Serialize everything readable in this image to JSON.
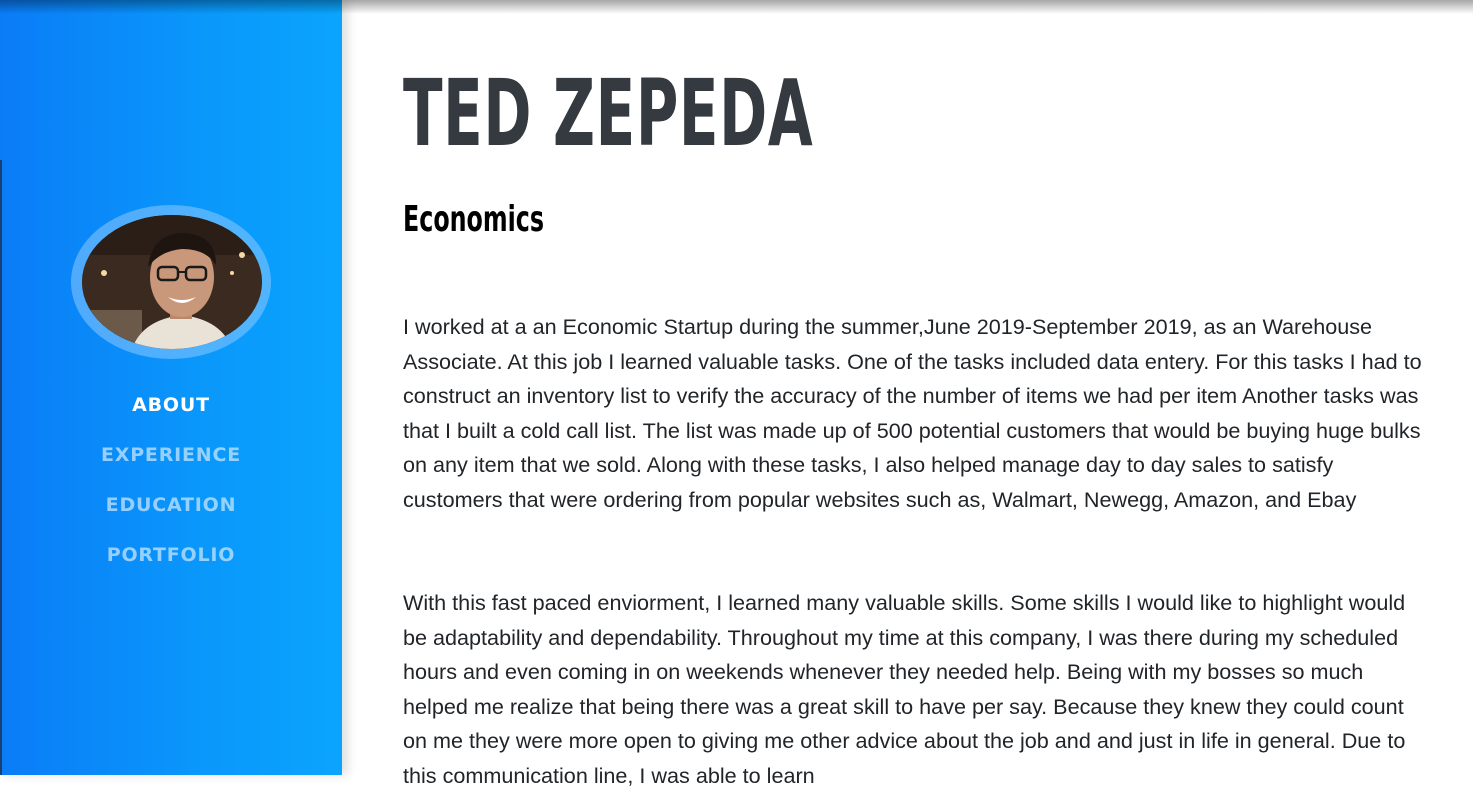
{
  "profile": {
    "name": "TED ZEPEDA",
    "subtitle": "Economics",
    "avatar_alt": "profile photo"
  },
  "nav": {
    "items": [
      {
        "label": "ABOUT",
        "active": true
      },
      {
        "label": "EXPERIENCE",
        "active": false
      },
      {
        "label": "EDUCATION",
        "active": false
      },
      {
        "label": "PORTFOLIO",
        "active": false
      }
    ]
  },
  "content": {
    "paragraphs": [
      "I worked at a an Economic Startup during the summer,June 2019-September 2019, as an Warehouse Associate. At this job I learned valuable tasks. One of the tasks included data entery. For this tasks I had to construct an inventory list to verify the accuracy of the number of items we had per item Another tasks was that I built a cold call list. The list was made up of 500 potential customers that would be buying huge bulks on any item that we sold. Along with these tasks, I also helped manage day to day sales to satisfy customers that were ordering from popular websites such as, Walmart, Newegg, Amazon, and Ebay",
      "With this fast paced enviorment, I learned many valuable skills. Some skills I would like to highlight would be adaptability and dependability. Throughout my time at this company, I was there during my scheduled hours and even coming in on weekends whenever they needed help. Being with my bosses so much helped me realize that being there was a great skill to have per say. Because they knew they could count on me they were more open to giving me other advice about the job and and just in life in general. Due to this communication line, I was able to learn"
    ]
  },
  "colors": {
    "sidebar_start": "#0a7cf7",
    "sidebar_end": "#0aa4fd",
    "heading": "#343a40",
    "nav_active": "#ffffff",
    "nav_inactive": "#bee1ff"
  }
}
